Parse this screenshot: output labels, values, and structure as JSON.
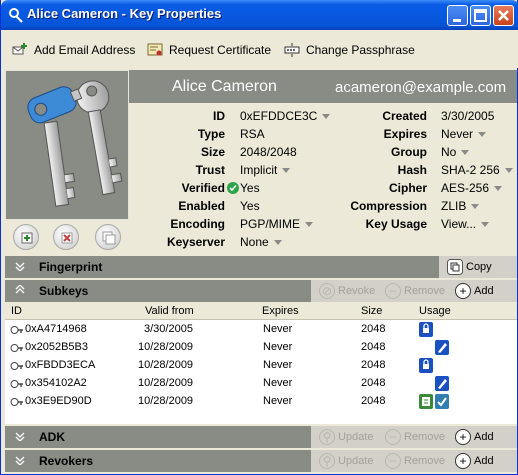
{
  "window": {
    "title": "Alice Cameron - Key Properties",
    "minimize_icon": "minimize-icon",
    "maximize_icon": "maximize-icon",
    "close_icon": "close-icon"
  },
  "toolbar": {
    "add_email": "Add Email Address",
    "request_cert": "Request Certificate",
    "change_pass": "Change Passphrase"
  },
  "key": {
    "name": "Alice Cameron",
    "email": "acameron@example.com",
    "left_fields": [
      {
        "label": "ID",
        "value": "0xEFDDCE3C",
        "dropdown": true
      },
      {
        "label": "Type",
        "value": "RSA",
        "dropdown": false
      },
      {
        "label": "Size",
        "value": "2048/2048",
        "dropdown": false
      },
      {
        "label": "Trust",
        "value": "Implicit",
        "dropdown": true
      },
      {
        "label": "Verified",
        "value": "Yes",
        "dropdown": false
      },
      {
        "label": "Enabled",
        "value": "Yes",
        "dropdown": false
      },
      {
        "label": "Encoding",
        "value": "PGP/MIME",
        "dropdown": true
      },
      {
        "label": "Keyserver",
        "value": "None",
        "dropdown": true
      }
    ],
    "right_fields": [
      {
        "label": "Created",
        "value": "3/30/2005",
        "dropdown": false
      },
      {
        "label": "Expires",
        "value": "Never",
        "dropdown": true
      },
      {
        "label": "Group",
        "value": "No",
        "dropdown": true
      },
      {
        "label": "Hash",
        "value": "SHA-2 256",
        "dropdown": true
      },
      {
        "label": "Cipher",
        "value": "AES-256",
        "dropdown": true
      },
      {
        "label": "Compression",
        "value": "ZLIB",
        "dropdown": true
      },
      {
        "label": "Key Usage",
        "value": "View...",
        "dropdown": true
      }
    ]
  },
  "sections": {
    "fingerprint": {
      "title": "Fingerprint",
      "copy": "Copy"
    },
    "subkeys": {
      "title": "Subkeys",
      "revoke": "Revoke",
      "remove": "Remove",
      "add": "Add"
    },
    "adk": {
      "title": "ADK",
      "update": "Update",
      "remove": "Remove",
      "add": "Add"
    },
    "revokers": {
      "title": "Revokers",
      "update": "Update",
      "remove": "Remove",
      "add": "Add"
    }
  },
  "subkeys_table": {
    "columns": [
      "ID",
      "Valid from",
      "Expires",
      "Size",
      "Usage"
    ],
    "rows": [
      {
        "id": "0xA4714968",
        "valid_from": "3/30/2005",
        "expires": "Never",
        "size": "2048",
        "usage": [
          "encrypt"
        ]
      },
      {
        "id": "0x2052B5B3",
        "valid_from": "10/28/2009",
        "expires": "Never",
        "size": "2048",
        "usage": [
          "sign"
        ]
      },
      {
        "id": "0xFBDD3ECA",
        "valid_from": "10/28/2009",
        "expires": "Never",
        "size": "2048",
        "usage": [
          "encrypt"
        ]
      },
      {
        "id": "0x354102A2",
        "valid_from": "10/28/2009",
        "expires": "Never",
        "size": "2048",
        "usage": [
          "sign"
        ]
      },
      {
        "id": "0x3E9ED90D",
        "valid_from": "10/28/2009",
        "expires": "Never",
        "size": "2048",
        "usage": [
          "auth",
          "sign-check"
        ]
      }
    ]
  }
}
